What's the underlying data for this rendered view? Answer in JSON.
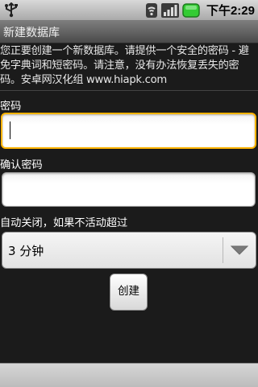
{
  "status_bar": {
    "clock": "下午2:29",
    "icons": [
      "usb-icon",
      "wifi-icon",
      "signal-icon",
      "battery-icon"
    ]
  },
  "title_bar": {
    "title": "新建数据库"
  },
  "description": "您正要创建一个新数据库。请提供一个安全的密码 - 避免字典词和短密码。请注意，没有办法恢复丢失的密码。安卓网汉化组 www.hiapk.com",
  "form": {
    "password": {
      "label": "密码",
      "value": ""
    },
    "confirm_password": {
      "label": "确认密码",
      "value": ""
    },
    "auto_close": {
      "label": "自动关闭，如果不活动超过",
      "selected": "3 分钟"
    },
    "create_label": "创建"
  },
  "colors": {
    "accent_focus": "#ffb400",
    "background": "#1b1b1b",
    "battery": "#33cc33"
  }
}
